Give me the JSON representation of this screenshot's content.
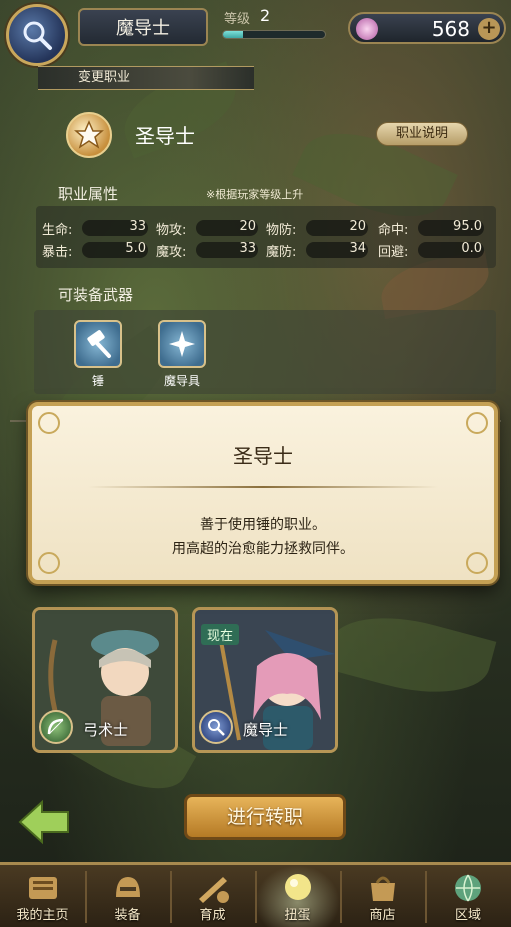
{
  "top": {
    "player_class": "魔导士",
    "level_label": "等级",
    "level_value": "2",
    "level_progress": 0.2,
    "gems": "568"
  },
  "section": {
    "title": "变更职业"
  },
  "class_info": {
    "name": "圣导士",
    "desc_button": "职业说明",
    "attr_title": "职业属性",
    "attr_note": "※根据玩家等级上升",
    "stats": [
      {
        "label": "生命:",
        "value": "33"
      },
      {
        "label": "物攻:",
        "value": "20"
      },
      {
        "label": "物防:",
        "value": "20"
      },
      {
        "label": "命中:",
        "value": "95.0"
      },
      {
        "label": "暴击:",
        "value": "5.0"
      },
      {
        "label": "魔攻:",
        "value": "33"
      },
      {
        "label": "魔防:",
        "value": "34"
      },
      {
        "label": "回避:",
        "value": "0.0"
      }
    ],
    "weapon_title": "可装备武器",
    "weapons": [
      {
        "label": "锤",
        "icon": "hammer-icon"
      },
      {
        "label": "魔导具",
        "icon": "magic-tool-icon"
      }
    ]
  },
  "dialog": {
    "title": "圣导士",
    "line1": "善于使用锤的职业。",
    "line2": "用高超的治愈能力拯救同伴。"
  },
  "cards": [
    {
      "name": "弓术士",
      "icon": "bow-icon",
      "now": ""
    },
    {
      "name": "魔导士",
      "icon": "staff-icon",
      "now": "现在"
    }
  ],
  "actions": {
    "change": "进行转职"
  },
  "nav": [
    {
      "label": "我的主页",
      "icon": "home-icon"
    },
    {
      "label": "装备",
      "icon": "helmet-icon"
    },
    {
      "label": "育成",
      "icon": "train-icon"
    },
    {
      "label": "扭蛋",
      "icon": "gacha-icon"
    },
    {
      "label": "商店",
      "icon": "shop-icon"
    },
    {
      "label": "区域",
      "icon": "area-icon"
    }
  ],
  "colors": {
    "accent_gold": "#c4a054",
    "button_orange": "#d79a3f",
    "progress_teal": "#5ec8c2"
  }
}
